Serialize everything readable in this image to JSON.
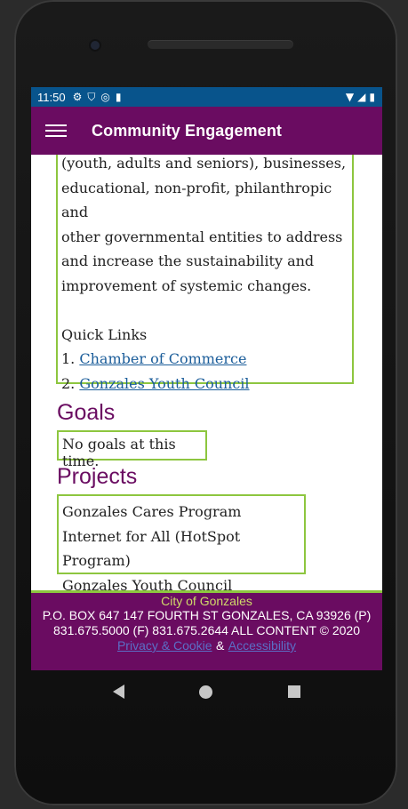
{
  "status": {
    "time": "11:50",
    "icons": [
      "gear-icon",
      "shield-icon",
      "at-sign-icon",
      "sd-card-icon"
    ],
    "right_icons": [
      "wifi-icon",
      "signal-icon",
      "battery-icon"
    ]
  },
  "appbar": {
    "title": "Community Engagement"
  },
  "description": {
    "lines": [
      "(youth, adults and seniors), businesses,",
      "educational, non-profit, philanthropic and",
      "other governmental entities to address",
      "and increase the sustainability and",
      "improvement of systemic changes."
    ],
    "quick_links_label": "Quick Links",
    "links": [
      {
        "num": "1.",
        "label": "Chamber of Commerce"
      },
      {
        "num": "2.",
        "label": "Gonzales Youth Council"
      }
    ]
  },
  "goals": {
    "heading": "Goals",
    "text": "No goals at this time."
  },
  "projects": {
    "heading": "Projects",
    "items": [
      "Gonzales Cares Program",
      "Internet for All (HotSpot Program)",
      "Gonzales Youth Council"
    ]
  },
  "footer": {
    "city": "City of Gonzales",
    "address": "P.O. BOX 647 147 FOURTH ST GONZALES, CA 93926 (P) 831.675.5000 (F) 831.675.2644 ALL CONTENT © 2020",
    "privacy": "Privacy & Cookie",
    "amp": "&",
    "accessibility": "Accessibility"
  },
  "colors": {
    "appbar": "#6a0c61",
    "statusbar": "#08548c",
    "border_green": "#8dc63f",
    "link": "#1b5d9a"
  }
}
